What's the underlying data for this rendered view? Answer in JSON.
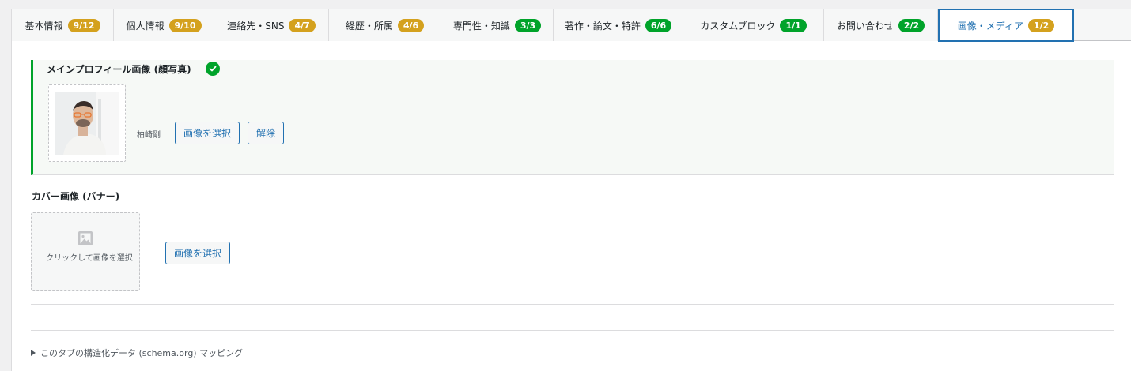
{
  "tabs": [
    {
      "label": "基本情報",
      "badge": "9/12",
      "state": "partial"
    },
    {
      "label": "個人情報",
      "badge": "9/10",
      "state": "partial"
    },
    {
      "label": "連絡先・SNS",
      "badge": "4/7",
      "state": "partial"
    },
    {
      "label": "経歴・所属",
      "badge": "4/6",
      "state": "partial"
    },
    {
      "label": "専門性・知識",
      "badge": "3/3",
      "state": "complete"
    },
    {
      "label": "著作・論文・特許",
      "badge": "6/6",
      "state": "complete"
    },
    {
      "label": "カスタムブロック",
      "badge": "1/1",
      "state": "complete"
    },
    {
      "label": "お問い合わせ",
      "badge": "2/2",
      "state": "complete"
    },
    {
      "label": "画像・メディア",
      "badge": "1/2",
      "state": "partial",
      "active": true
    }
  ],
  "colors": {
    "partial_badge": "#d4a11e",
    "complete_badge": "#00a32a",
    "accent": "#2271b1",
    "success_border": "#00a32a"
  },
  "main_image": {
    "title": "メインプロフィール画像 (顔写真)",
    "check_icon": "check-circle-icon",
    "image_name": "柏崎剛",
    "select_label": "画像を選択",
    "remove_label": "解除"
  },
  "cover_image": {
    "title": "カバー画像 (バナー)",
    "placeholder_icon": "image-placeholder-icon",
    "placeholder_text": "クリックして画像を選択",
    "select_label": "画像を選択"
  },
  "schema": {
    "toggle_label": "このタブの構造化データ (schema.org) マッピング"
  }
}
